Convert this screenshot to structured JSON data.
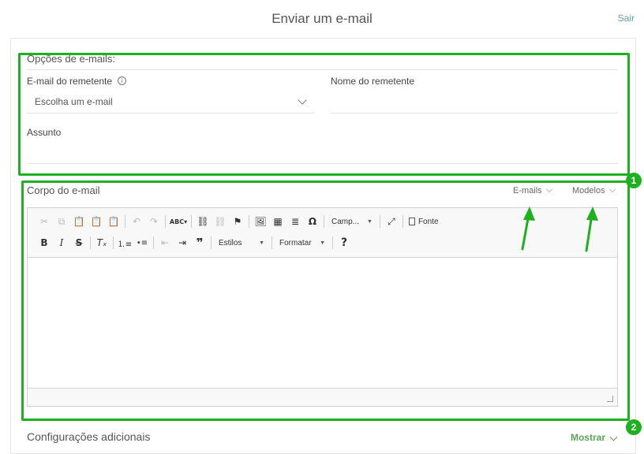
{
  "header": {
    "title": "Enviar um e-mail",
    "exit_label": "Sair"
  },
  "options": {
    "section_title": "Opções de e-mails:",
    "sender_email_label": "E-mail do remetente",
    "sender_email_value": "Escolha um e-mail",
    "sender_name_label": "Nome do remetente",
    "subject_label": "Assunto"
  },
  "body": {
    "section_title": "Corpo do e-mail",
    "emails_tab": "E-mails",
    "templates_tab": "Modelos",
    "toolbar": {
      "fields_combo": "Camp...",
      "source_label": "Fonte",
      "styles_combo": "Estilos",
      "format_combo": "Formatar"
    }
  },
  "additional": {
    "title": "Configurações adicionais",
    "show_label": "Mostrar"
  },
  "annotations": {
    "badge_1": "1",
    "badge_2": "2"
  },
  "colors": {
    "annotation": "#1fb01f",
    "accent_teal": "#5aa0a8",
    "accent_green": "#5aa55a"
  }
}
